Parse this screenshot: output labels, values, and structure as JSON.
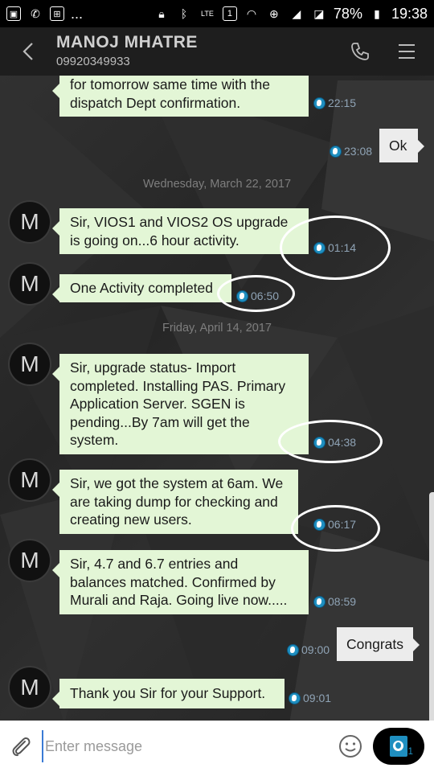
{
  "status_bar": {
    "left_more": "...",
    "network": "LTE",
    "sim": "1",
    "battery": "78%",
    "time": "19:38"
  },
  "header": {
    "contact_name": "MANOJ MHATRE",
    "contact_number": "09920349933"
  },
  "dates": [
    "Wednesday, March 22, 2017",
    "Friday, April 14, 2017"
  ],
  "messages": [
    {
      "dir": "in",
      "text": "for tomorrow same time with the dispatch Dept confirmation.",
      "time": "22:15"
    },
    {
      "dir": "out",
      "text": "Ok",
      "time": "23:08"
    },
    {
      "dir": "in",
      "text": "Sir, VIOS1 and VIOS2 OS upgrade is going on...6 hour activity.",
      "time": "01:14",
      "avatar": "M"
    },
    {
      "dir": "in",
      "text": "One Activity completed",
      "time": "06:50",
      "avatar": "M"
    },
    {
      "dir": "in",
      "text": "Sir, upgrade status- Import completed. Installing PAS. Primary Application Server. SGEN is pending...By 7am will get the system.",
      "time": "04:38",
      "avatar": "M"
    },
    {
      "dir": "in",
      "text": "Sir, we got the system at 6am. We are taking dump for checking and creating new users.",
      "time": "06:17",
      "avatar": "M"
    },
    {
      "dir": "in",
      "text": "Sir, 4.7 and 6.7 entries and balances matched. Confirmed by Murali and Raja. Going live now.....",
      "time": "08:59",
      "avatar": "M"
    },
    {
      "dir": "out",
      "text": "Congrats",
      "time": "09:00"
    },
    {
      "dir": "in",
      "text": "Thank you Sir for your Support.",
      "time": "09:01",
      "avatar": "M"
    }
  ],
  "input": {
    "placeholder": "Enter message",
    "send_count": "1"
  },
  "icons": {
    "back": "chevron-left-icon",
    "call": "phone-icon",
    "menu": "menu-icon",
    "attach": "paperclip-icon",
    "emoji": "smiley-icon",
    "send": "send-icon"
  },
  "colors": {
    "incoming_bubble": "#e3f6d6",
    "outgoing_bubble": "#ececec",
    "accent": "#1f8fc0"
  }
}
